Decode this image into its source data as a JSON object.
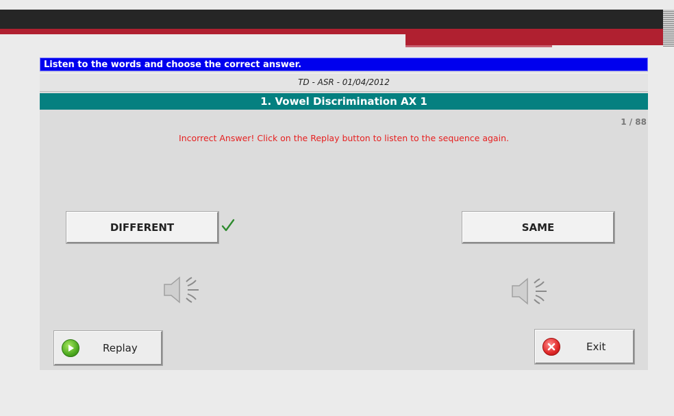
{
  "instruction": "Listen to the words and choose the correct answer.",
  "session_info": "TD - ASR - 01/04/2012",
  "exercise_title": "1. Vowel Discrimination AX 1",
  "progress": "1 / 88",
  "feedback_message": "Incorrect Answer!  Click on the Replay button to listen to the sequence again.",
  "choices": {
    "different_label": "DIFFERENT",
    "same_label": "SAME",
    "correct_choice": "DIFFERENT"
  },
  "buttons": {
    "replay_label": "Replay",
    "exit_label": "Exit"
  },
  "icons": {
    "check": "check-icon",
    "speaker": "speaker-icon",
    "play": "play-icon",
    "close": "close-icon"
  },
  "colors": {
    "instruction_bg": "#0000ee",
    "title_bg": "#058080",
    "feedback_text": "#e62020",
    "check": "#2e8b2e"
  }
}
